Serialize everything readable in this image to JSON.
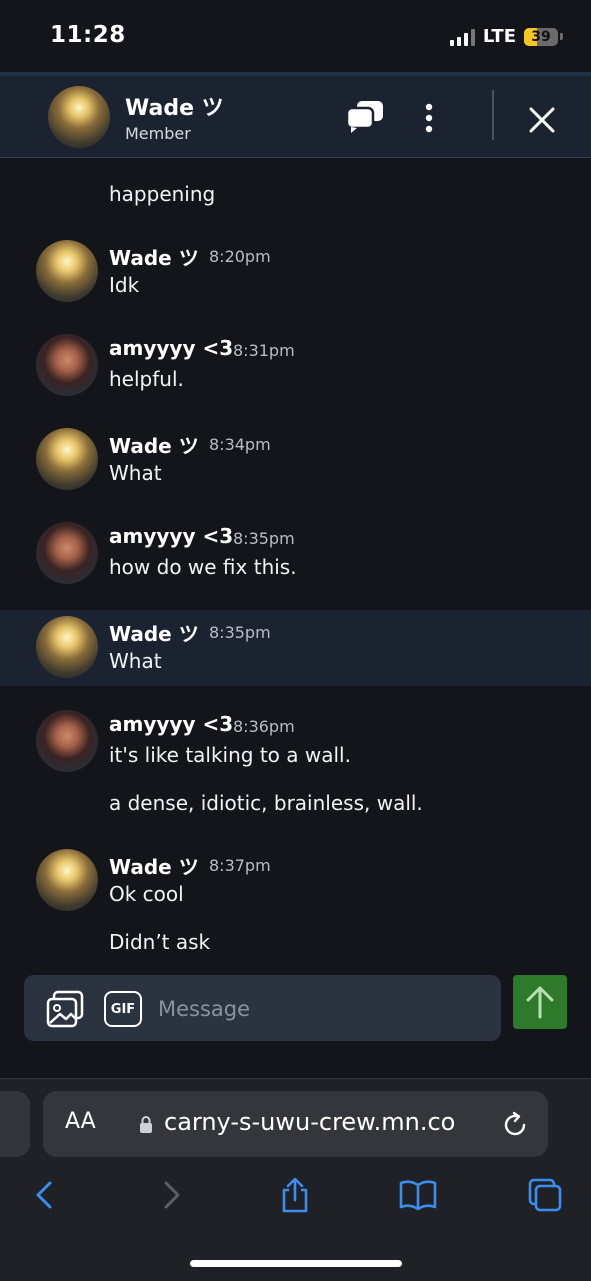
{
  "status_bar": {
    "time": "11:28",
    "network": "LTE",
    "battery": "39",
    "battery_level": 0.39
  },
  "header": {
    "name": "Wade ツ",
    "role": "Member"
  },
  "messages": [
    {
      "author": "",
      "time": "",
      "lines": [
        "happening"
      ]
    },
    {
      "author": "Wade ツ",
      "time": "8:20pm",
      "lines": [
        "Idk"
      ]
    },
    {
      "author": "amyyyy <3",
      "time": "8:31pm",
      "lines": [
        "helpful."
      ]
    },
    {
      "author": "Wade ツ",
      "time": "8:34pm",
      "lines": [
        "What"
      ]
    },
    {
      "author": "amyyyy <3",
      "time": "8:35pm",
      "lines": [
        "how do we fix this."
      ]
    },
    {
      "author": "Wade ツ",
      "time": "8:35pm",
      "lines": [
        "What"
      ]
    },
    {
      "author": "amyyyy <3",
      "time": "8:36pm",
      "lines": [
        "it's like talking to a wall.",
        "a dense, idiotic, brainless, wall."
      ]
    },
    {
      "author": "Wade ツ",
      "time": "8:37pm",
      "lines": [
        "Ok cool",
        "Didn’t ask"
      ]
    }
  ],
  "composer": {
    "gif_label": "GIF",
    "placeholder": "Message"
  },
  "browser": {
    "text_size_label": "AA",
    "url": "carny-s-uwu-crew.mn.co"
  },
  "colors": {
    "send_button": "#2e7a2a",
    "background": "#14151b",
    "header": "#1b2330",
    "highlight_row": "#1b2230",
    "browser_icon": "#3a8ef0"
  }
}
